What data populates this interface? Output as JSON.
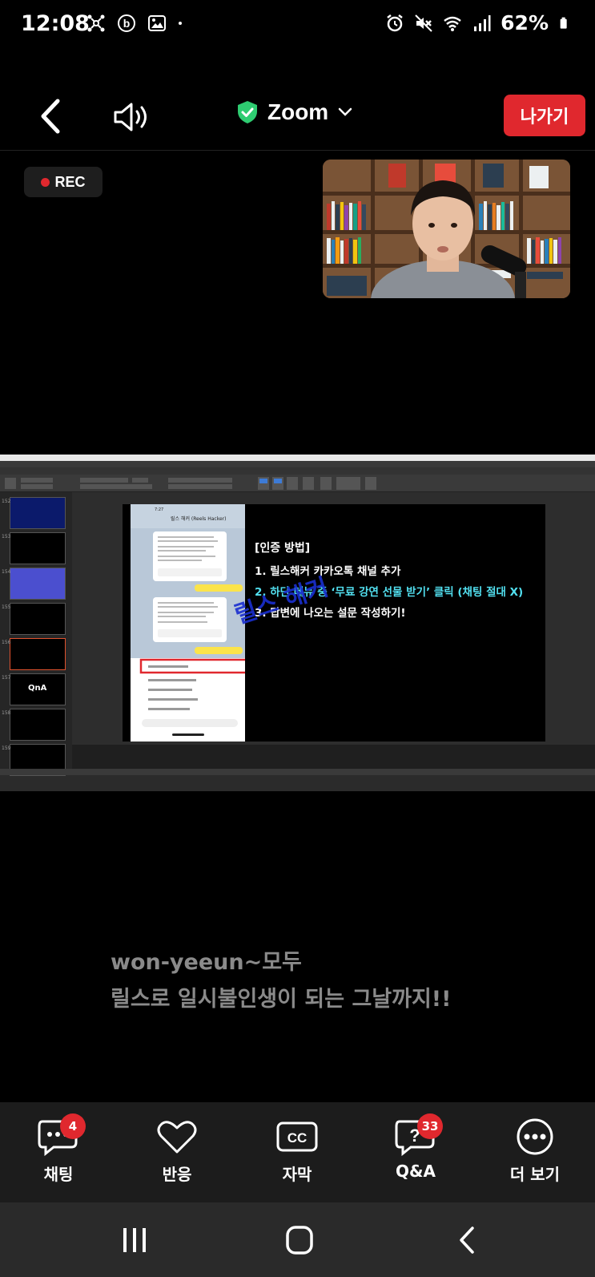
{
  "status_bar": {
    "time": "12:08",
    "battery": "62%",
    "left_icons": [
      "network-icon",
      "b-app-icon",
      "gallery-icon",
      "dot-icon"
    ],
    "right_icons": [
      "alarm-icon",
      "mute-icon",
      "wifi-icon",
      "signal-icon",
      "battery-icon"
    ]
  },
  "top_bar": {
    "title": "Zoom",
    "leave_label": "나가기",
    "secure_color": "#2ecc71",
    "leave_color": "#e0282e"
  },
  "rec": {
    "label": "REC"
  },
  "slide": {
    "heading": "[인증 방법]",
    "steps": [
      "1.  릴스해커 카카오톡 채널 추가",
      "2.  하단 메뉴 중 ‘무료 강연 선물 받기’ 클릭 (채팅 절대 X)",
      "3.  답변에 나오는 설문 작성하기!"
    ],
    "watermark": "릴스 해커",
    "phone_header": "릴스 해커 (Reels Hacker)"
  },
  "thumbs": [
    {
      "num": "152"
    },
    {
      "num": "153"
    },
    {
      "num": "154"
    },
    {
      "num": "155"
    },
    {
      "num": "156"
    },
    {
      "num": "157",
      "text": "QnA"
    },
    {
      "num": "158"
    },
    {
      "num": "159"
    }
  ],
  "caption": {
    "line1": "won-yeeun~모두",
    "line2": "릴스로 일시불인생이 되는 그날까지!!"
  },
  "toolbar": {
    "items": [
      {
        "label": "채팅",
        "badge": "4",
        "icon": "chat-icon"
      },
      {
        "label": "반응",
        "badge": "",
        "icon": "heart-icon"
      },
      {
        "label": "자막",
        "badge": "",
        "icon": "cc-icon"
      },
      {
        "label": "Q&A",
        "badge": "33",
        "icon": "qa-icon"
      },
      {
        "label": "더 보기",
        "badge": "",
        "icon": "more-icon"
      }
    ]
  },
  "nav": {
    "icons": [
      "recents-icon",
      "home-icon",
      "back-nav-icon"
    ]
  }
}
